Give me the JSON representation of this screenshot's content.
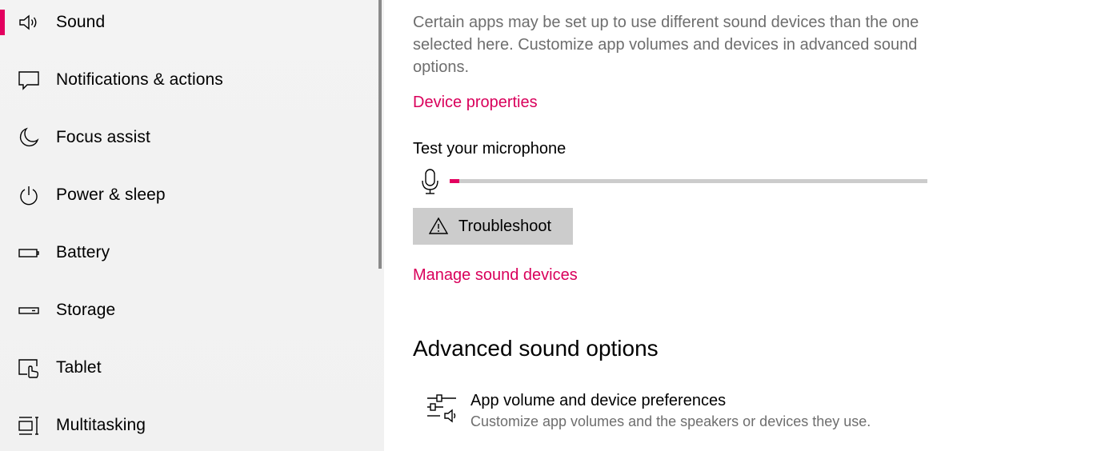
{
  "sidebar": {
    "items": [
      {
        "label": "Sound",
        "icon": "speaker-icon",
        "selected": true
      },
      {
        "label": "Notifications & actions",
        "icon": "message-icon",
        "selected": false
      },
      {
        "label": "Focus assist",
        "icon": "moon-icon",
        "selected": false
      },
      {
        "label": "Power & sleep",
        "icon": "power-icon",
        "selected": false
      },
      {
        "label": "Battery",
        "icon": "battery-icon",
        "selected": false
      },
      {
        "label": "Storage",
        "icon": "storage-icon",
        "selected": false
      },
      {
        "label": "Tablet",
        "icon": "tablet-icon",
        "selected": false
      },
      {
        "label": "Multitasking",
        "icon": "multitasking-icon",
        "selected": false
      }
    ]
  },
  "main": {
    "description": "Certain apps may be set up to use different sound devices than the one selected here. Customize app volumes and devices in advanced sound options.",
    "device_properties_link": "Device properties",
    "test_mic_label": "Test your microphone",
    "mic_level_fraction": 0.02,
    "troubleshoot_label": "Troubleshoot",
    "manage_devices_link": "Manage sound devices",
    "advanced_title": "Advanced sound options",
    "app_pref": {
      "title": "App volume and device preferences",
      "subtitle": "Customize app volumes and the speakers or devices they use."
    }
  },
  "colors": {
    "accent": "#e3005f",
    "link": "#d9005b",
    "secondary_text": "#6e6e6e",
    "sidebar_bg": "#f2f2f2",
    "button_bg": "#cccccc"
  }
}
